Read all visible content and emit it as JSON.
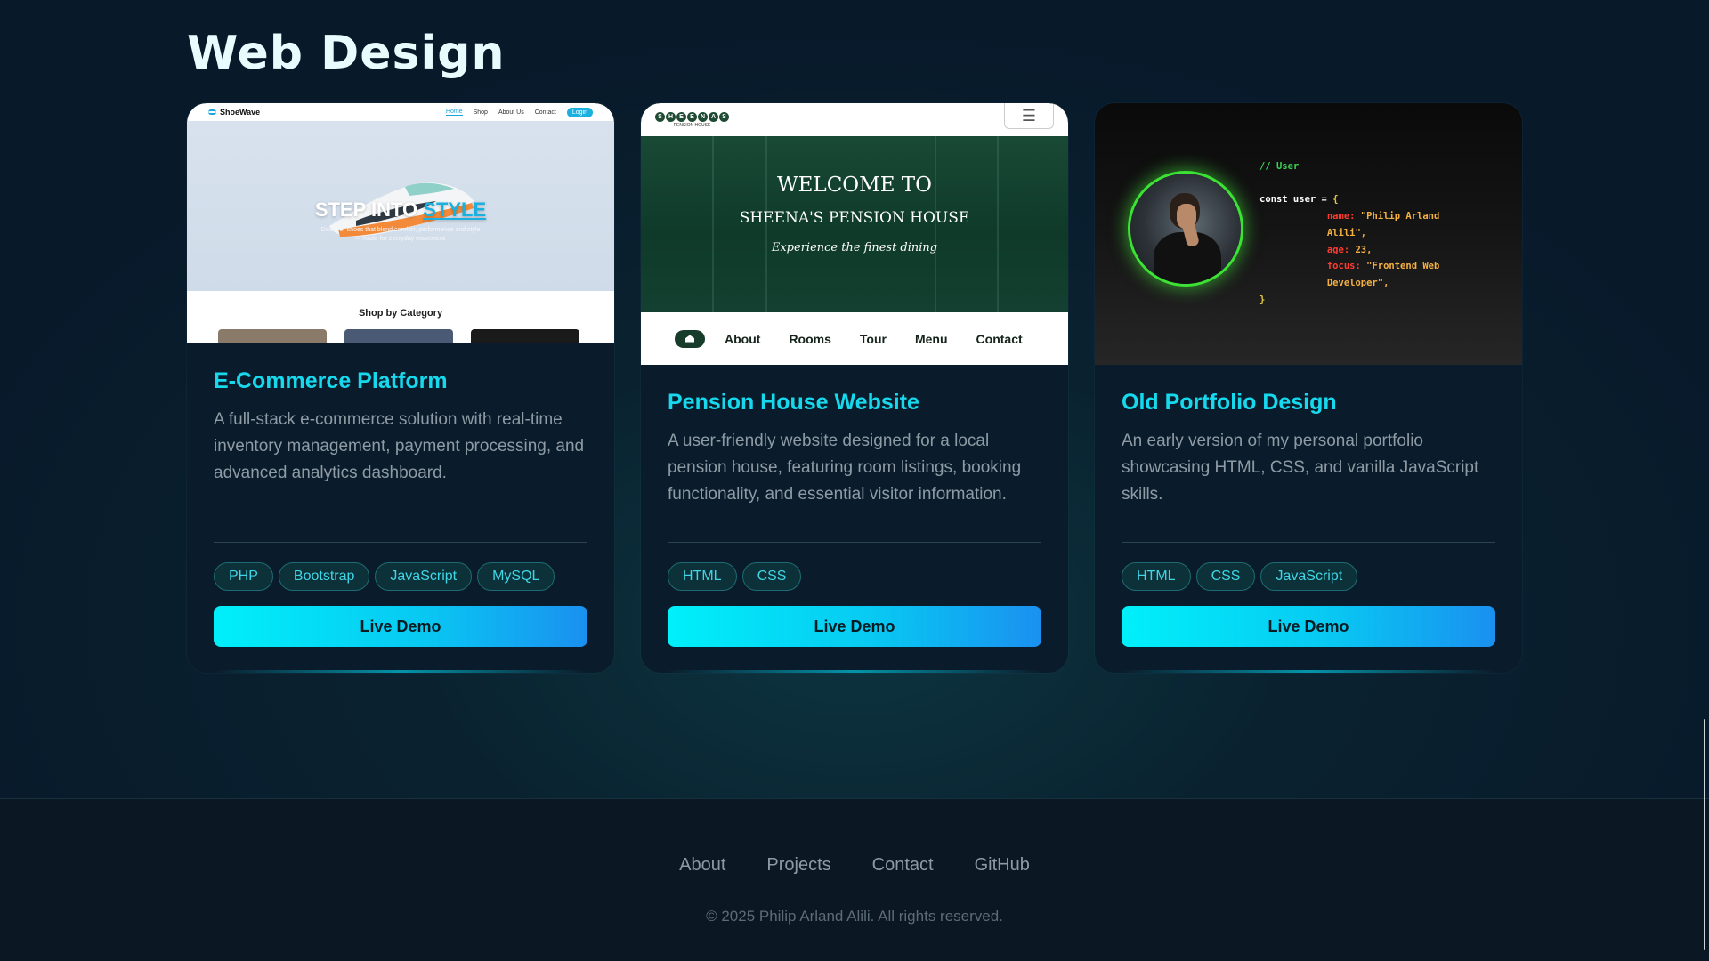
{
  "section": {
    "title": "Web Design"
  },
  "projects": [
    {
      "title": "E-Commerce Platform",
      "description": "A full-stack e-commerce solution with real-time inventory management, payment processing, and advanced analytics dashboard.",
      "tags": [
        "PHP",
        "Bootstrap",
        "JavaScript",
        "MySQL"
      ],
      "button": "Live Demo",
      "preview": {
        "logo": "ShoeWave",
        "nav": [
          "Home",
          "Shop",
          "About Us",
          "Contact"
        ],
        "login": "Login",
        "headline_a": "STEP INTO",
        "headline_b": "STYLE",
        "subtext": "Discover shoes that blend comfort, performance and style — made for everyday movement.",
        "category_title": "Shop by Category"
      }
    },
    {
      "title": "Pension House Website",
      "description": "A user-friendly website designed for a local pension house, featuring room listings, booking functionality, and essential visitor information.",
      "tags": [
        "HTML",
        "CSS"
      ],
      "button": "Live Demo",
      "preview": {
        "logo_letters": [
          "S",
          "H",
          "E",
          "E",
          "N",
          "A",
          "S"
        ],
        "logo_sub": "PENSION HOUSE",
        "hero_line1": "WELCOME TO",
        "hero_line2": "SHEENA'S PENSION HOUSE",
        "hero_line3": "Experience the finest dining",
        "nav": [
          "About",
          "Rooms",
          "Tour",
          "Menu",
          "Contact"
        ]
      }
    },
    {
      "title": "Old Portfolio Design",
      "description": "An early version of my personal portfolio showcasing HTML, CSS, and vanilla JavaScript skills.",
      "tags": [
        "HTML",
        "CSS",
        "JavaScript"
      ],
      "button": "Live Demo",
      "preview": {
        "code_comment": "// User",
        "code_decl": "const user = ",
        "code_open": "{",
        "name_key": "name:",
        "name_val_1": "\"Philip Arland",
        "name_val_2": "Alili\",",
        "age_key": "age:",
        "age_val": "23,",
        "focus_key": "focus:",
        "focus_val_1": "\"Frontend Web",
        "focus_val_2": "Developer\",",
        "code_close": "}"
      }
    }
  ],
  "footer": {
    "links": [
      "About",
      "Projects",
      "Contact",
      "GitHub"
    ],
    "copyright": "© 2025 Philip Arland Alili. All rights reserved."
  },
  "colors": {
    "accent": "#17d9ee",
    "button_gradient_start": "#00f0fa",
    "button_gradient_end": "#1a90f0",
    "background": "#0a2230"
  }
}
